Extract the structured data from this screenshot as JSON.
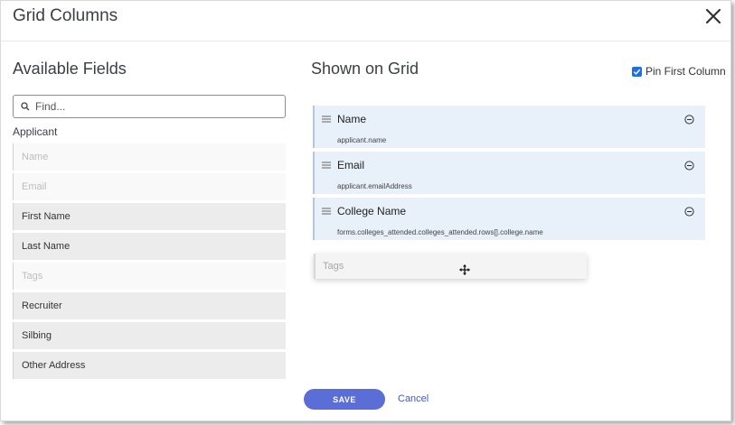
{
  "dialog": {
    "title": "Grid Columns",
    "close_icon": "close-icon"
  },
  "available": {
    "title": "Available Fields",
    "search": {
      "placeholder": "Find...",
      "value": ""
    },
    "group_label": "Applicant",
    "fields": [
      {
        "label": "Name",
        "state": "disabled"
      },
      {
        "label": "Email",
        "state": "disabled"
      },
      {
        "label": "First Name",
        "state": "enabled"
      },
      {
        "label": "Last Name",
        "state": "enabled"
      },
      {
        "label": "Tags",
        "state": "disabled"
      },
      {
        "label": "Recruiter",
        "state": "enabled"
      },
      {
        "label": "Silbing",
        "state": "enabled"
      },
      {
        "label": "Other Address",
        "state": "enabled"
      }
    ]
  },
  "shown": {
    "title": "Shown on Grid",
    "pin_first_column": {
      "label": "Pin First Column",
      "checked": true
    },
    "items": [
      {
        "name": "Name",
        "path": "applicant.name"
      },
      {
        "name": "Email",
        "path": "applicant.emailAddress"
      },
      {
        "name": "College Name",
        "path": "forms.colleges_attended.colleges_attended.rows[].college.name"
      }
    ],
    "dragging_item": "Tags"
  },
  "footer": {
    "save_label": "SAVE",
    "cancel_label": "Cancel"
  },
  "colors": {
    "accent": "#5b6dd6",
    "link": "#3f57c9",
    "checkbox": "#1f6fde",
    "shown_item_bg": "#e8f0fa"
  }
}
